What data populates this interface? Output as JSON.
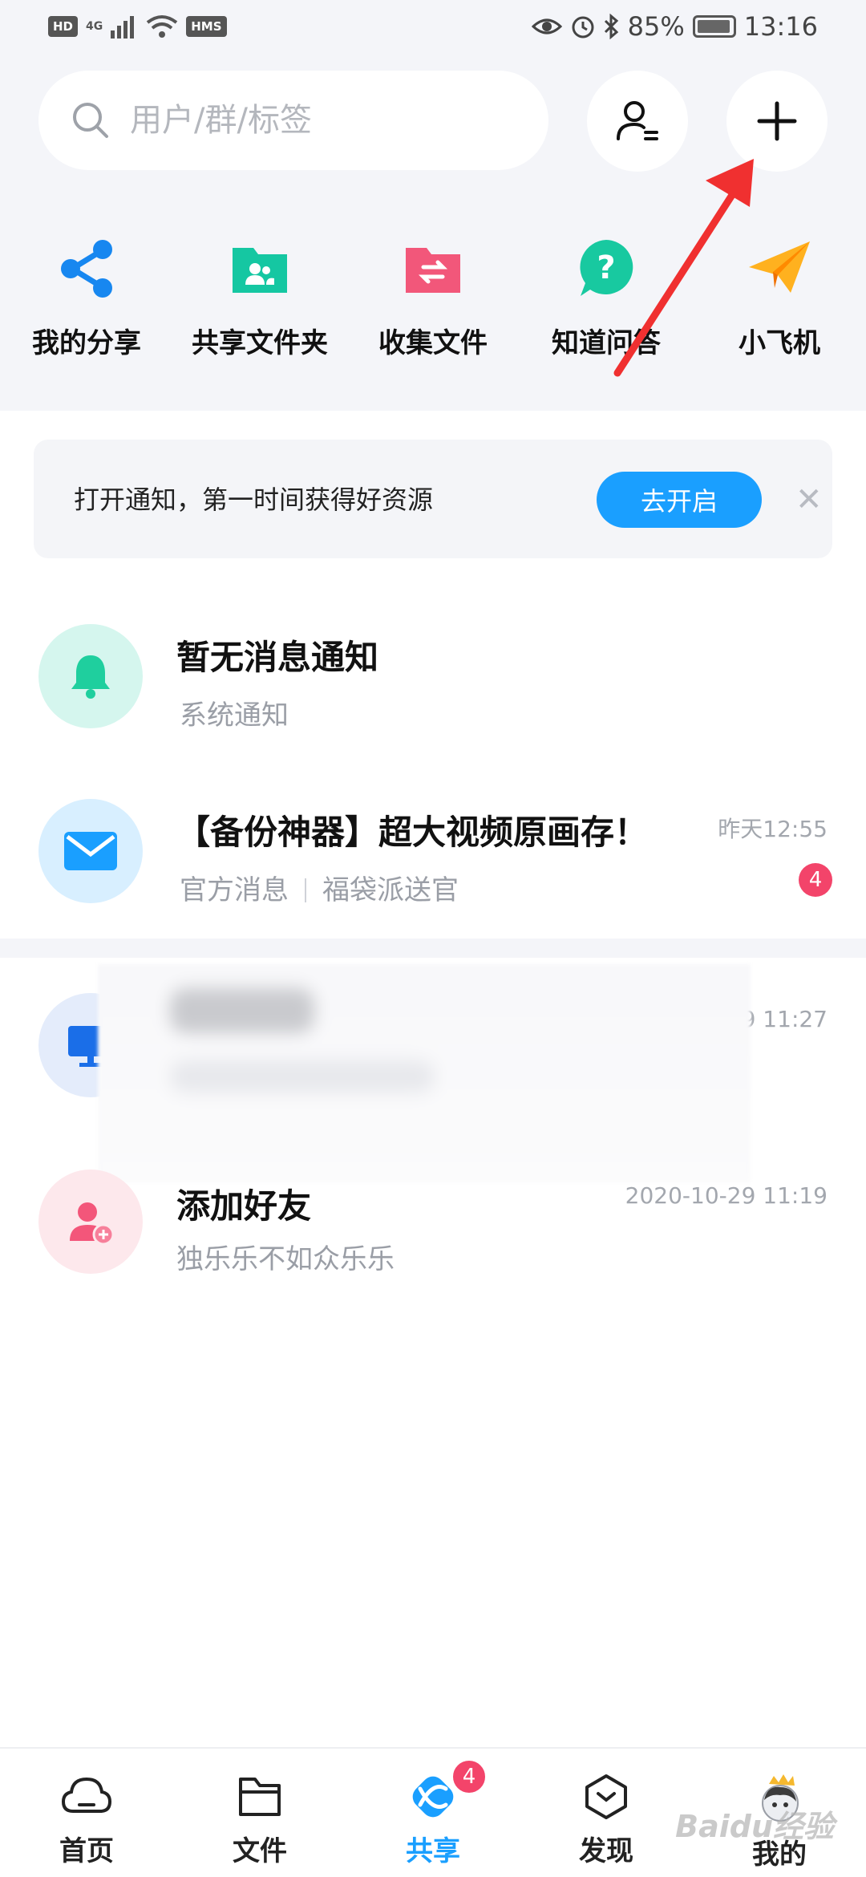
{
  "status_bar": {
    "left_chips": [
      "HD",
      "4G",
      "HMS"
    ],
    "battery": "85%",
    "time": "13:16"
  },
  "search": {
    "placeholder": "用户/群/标签"
  },
  "quick_actions": [
    {
      "label": "我的分享",
      "icon": "share-icon"
    },
    {
      "label": "共享文件夹",
      "icon": "shared-folder-icon"
    },
    {
      "label": "收集文件",
      "icon": "collect-folder-icon"
    },
    {
      "label": "知道问答",
      "icon": "question-icon"
    },
    {
      "label": "小飞机",
      "icon": "paper-plane-icon"
    }
  ],
  "notice": {
    "text": "打开通知，第一时间获得好资源",
    "button": "去开启"
  },
  "messages": [
    {
      "title": "暂无消息通知",
      "sub": "系统通知",
      "time": "",
      "icon": "bell-icon"
    },
    {
      "title": "【备份神器】超大视频原画存！",
      "sub_left": "官方消息",
      "sub_right": "福袋派送官",
      "time": "昨天12:55",
      "badge": "4",
      "icon": "mail-icon"
    },
    {
      "title": "",
      "sub": "",
      "time": "9 11:27",
      "icon": "monitor-icon"
    },
    {
      "title": "添加好友",
      "sub": "独乐乐不如众乐乐",
      "time": "2020-10-29 11:19",
      "icon": "add-user-icon"
    }
  ],
  "bottom_nav": [
    {
      "label": "首页",
      "icon": "cloud-icon"
    },
    {
      "label": "文件",
      "icon": "folder-icon"
    },
    {
      "label": "共享",
      "icon": "share-nav-icon",
      "badge": "4",
      "active": true
    },
    {
      "label": "发现",
      "icon": "discover-icon"
    },
    {
      "label": "我的",
      "icon": "profile-avatar"
    }
  ],
  "watermark": "Baidu经验",
  "colors": {
    "accent": "#1a9fff",
    "badge": "#f3446a",
    "annotation": "#f03030"
  }
}
